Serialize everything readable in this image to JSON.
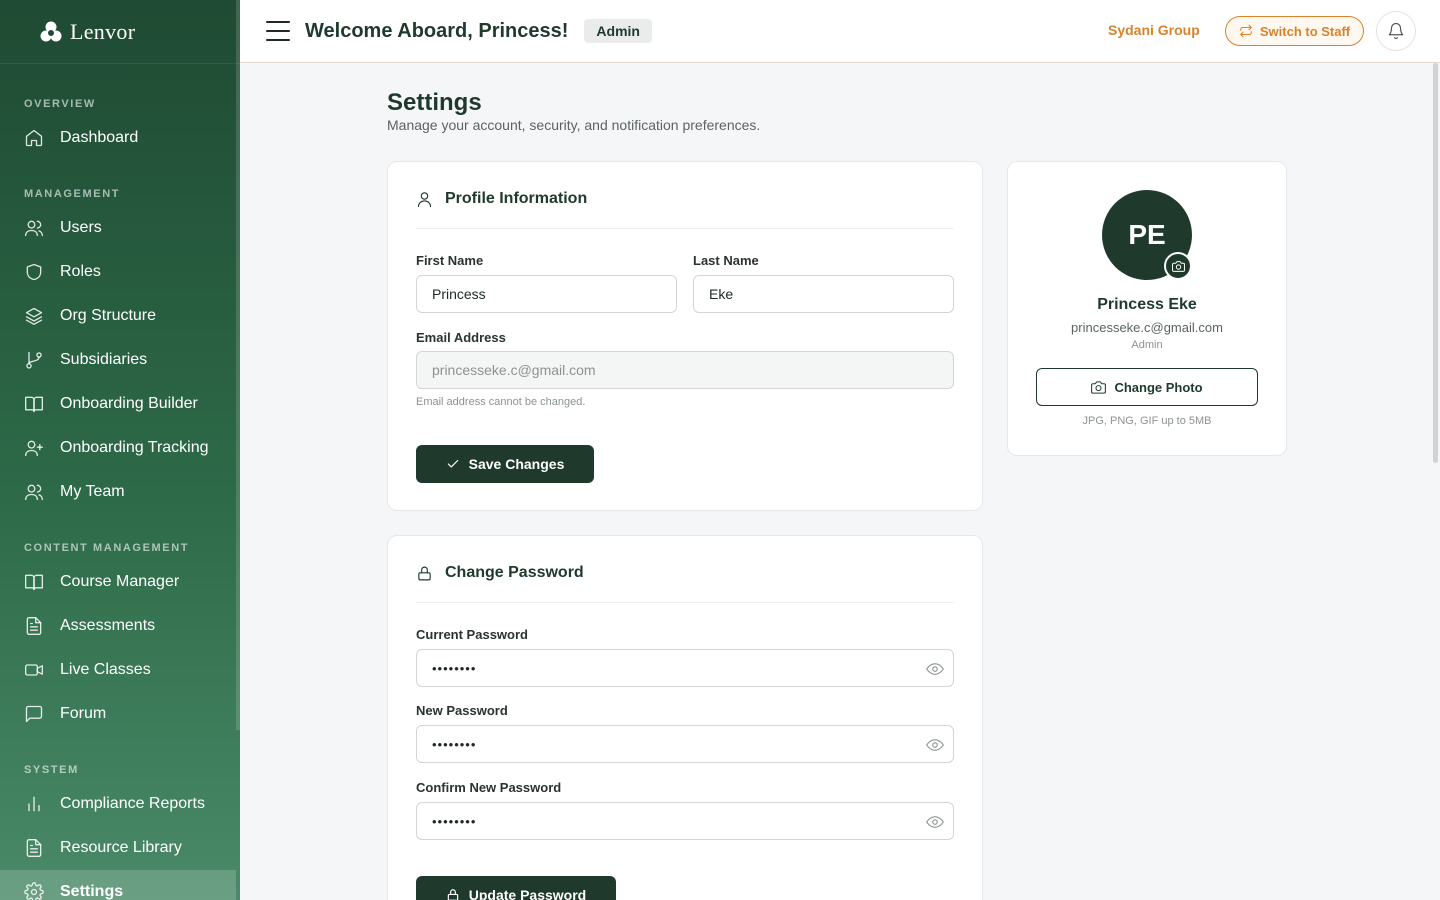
{
  "brand": {
    "name": "Lenvor"
  },
  "sidebar": {
    "sections": [
      {
        "label": "OVERVIEW",
        "items": [
          {
            "label": "Dashboard",
            "icon": "home-icon"
          }
        ]
      },
      {
        "label": "MANAGEMENT",
        "items": [
          {
            "label": "Users",
            "icon": "users-icon"
          },
          {
            "label": "Roles",
            "icon": "shield-icon"
          },
          {
            "label": "Org Structure",
            "icon": "layers-icon"
          },
          {
            "label": "Subsidiaries",
            "icon": "branch-icon"
          },
          {
            "label": "Onboarding Builder",
            "icon": "book-icon"
          },
          {
            "label": "Onboarding Tracking",
            "icon": "user-plus-icon"
          },
          {
            "label": "My Team",
            "icon": "users-icon"
          }
        ]
      },
      {
        "label": "CONTENT MANAGEMENT",
        "items": [
          {
            "label": "Course Manager",
            "icon": "book-icon"
          },
          {
            "label": "Assessments",
            "icon": "file-text-icon"
          },
          {
            "label": "Live Classes",
            "icon": "video-icon"
          },
          {
            "label": "Forum",
            "icon": "message-icon"
          }
        ]
      },
      {
        "label": "SYSTEM",
        "items": [
          {
            "label": "Compliance Reports",
            "icon": "bar-chart-icon"
          },
          {
            "label": "Resource Library",
            "icon": "file-text-icon"
          },
          {
            "label": "Settings",
            "icon": "gear-icon",
            "active": true
          }
        ]
      }
    ]
  },
  "header": {
    "welcome": "Welcome Aboard, Princess!",
    "role_badge": "Admin",
    "org_name": "Sydani Group",
    "switch_label": "Switch to Staff"
  },
  "page": {
    "title": "Settings",
    "subtitle": "Manage your account, security, and notification preferences."
  },
  "profile": {
    "title": "Profile Information",
    "first_name_label": "First Name",
    "first_name": "Princess",
    "last_name_label": "Last Name",
    "last_name": "Eke",
    "email_label": "Email Address",
    "email_placeholder": "princesseke.c@gmail.com",
    "email_hint": "Email address cannot be changed.",
    "save_label": "Save Changes"
  },
  "password": {
    "title": "Change Password",
    "current_label": "Current Password",
    "current_value": "••••••••",
    "new_label": "New Password",
    "new_value": "••••••••",
    "confirm_label": "Confirm New Password",
    "confirm_value": "••••••••",
    "update_label": "Update Password"
  },
  "avatar_card": {
    "initials": "PE",
    "name": "Princess Eke",
    "email": "princesseke.c@gmail.com",
    "role": "Admin",
    "change_photo_label": "Change Photo",
    "photo_hint": "JPG, PNG, GIF up to 5MB"
  },
  "colors": {
    "primary": "#1f3a2c",
    "accent": "#d9822b"
  }
}
